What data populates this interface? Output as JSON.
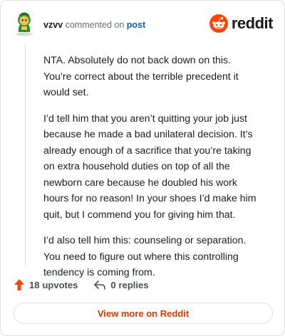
{
  "header": {
    "username": "vzvv",
    "verb": "commented on",
    "post_link": "post",
    "brand": "reddit"
  },
  "comment": {
    "paragraphs": [
      "NTA. Absolutely do not back down on this. You’re correct about the terrible precedent it would set.",
      "I’d tell him that you aren’t quitting your job just because he made a bad unilateral decision. It’s already enough of a sacrifice that you’re taking on extra household duties on top of all the newborn care because he doubled his work hours for no reason! In your shoes I’d make him quit, but I commend you for giving him that.",
      "I’d also tell him this: counseling or separation. You need to figure out where this controlling tendency is coming from."
    ]
  },
  "actions": {
    "upvotes_count": "18",
    "upvotes_unit": "upvotes",
    "replies_count": "0",
    "replies_unit": "replies"
  },
  "footer": {
    "view_more_label": "View more on Reddit"
  },
  "colors": {
    "brand_orange": "#ff4500",
    "link_blue": "#1a5fb4",
    "cta_text": "#d93a00"
  },
  "icons": {
    "avatar": "snoo-avatar-icon",
    "brand_logo": "reddit-logo-icon",
    "upvote": "upvote-arrow-icon",
    "reply": "reply-icon"
  }
}
